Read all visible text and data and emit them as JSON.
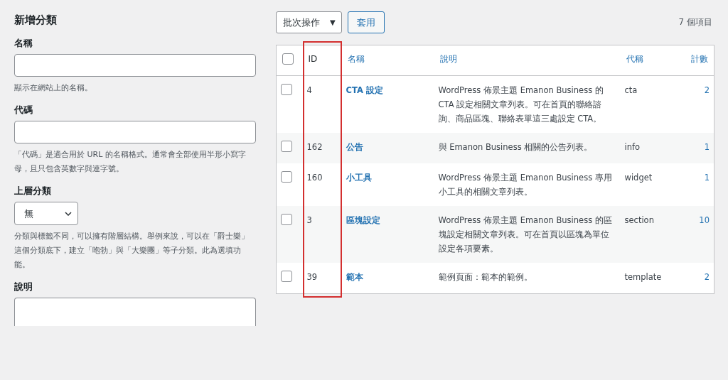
{
  "form": {
    "title": "新增分類",
    "fields": [
      {
        "kind": "text",
        "label": "名稱",
        "help": "顯示在網站上的名稱。"
      },
      {
        "kind": "text",
        "label": "代碼",
        "help": "「代碼」是適合用於 URL 的名稱格式。通常會全部使用半形小寫字母，且只包含英數字與連字號。"
      },
      {
        "kind": "select",
        "label": "上層分類",
        "value": "無",
        "help": "分類與標籤不同，可以擁有階層結構。舉例來說，可以在「爵士樂」這個分類底下，建立「咆勃」與「大樂團」等子分類。此為選填功能。"
      },
      {
        "kind": "textarea",
        "label": "說明"
      }
    ]
  },
  "toolbar": {
    "bulk_action": "批次操作",
    "bulk_caret": "▼",
    "apply": "套用",
    "item_count": "7 個項目"
  },
  "table": {
    "select_all_checked": false,
    "columns": [
      {
        "label": "ID",
        "kind": "plain",
        "highlighted": true
      },
      {
        "label": "名稱",
        "kind": "link",
        "highlighted": false
      },
      {
        "label": "說明",
        "kind": "link",
        "highlighted": false
      },
      {
        "label": "代稱",
        "kind": "link",
        "highlighted": false
      },
      {
        "label": "計數",
        "kind": "link",
        "highlighted": false
      }
    ],
    "rows": [
      {
        "checked": false,
        "id": "4",
        "name": "CTA 設定",
        "description": "WordPress 佈景主題 Emanon Business 的 CTA 設定相關文章列表。可在首頁的聯絡諮詢、商品區塊、聯絡表單這三處設定 CTA。",
        "slug": "cta",
        "count": "2"
      },
      {
        "checked": false,
        "id": "162",
        "name": "公告",
        "description": "與 Emanon Business 相關的公告列表。",
        "slug": "info",
        "count": "1"
      },
      {
        "checked": false,
        "id": "160",
        "name": "小工具",
        "description": "WordPress 佈景主題 Emanon Business 專用小工具的相關文章列表。",
        "slug": "widget",
        "count": "1"
      },
      {
        "checked": false,
        "id": "3",
        "name": "區塊設定",
        "description": "WordPress 佈景主題 Emanon Business 的區塊設定相關文章列表。可在首頁以區塊為單位設定各項要素。",
        "slug": "section",
        "count": "10"
      },
      {
        "checked": false,
        "id": "39",
        "name": "範本",
        "description": "範例頁面：範本的範例。",
        "slug": "template",
        "count": "2"
      }
    ]
  }
}
